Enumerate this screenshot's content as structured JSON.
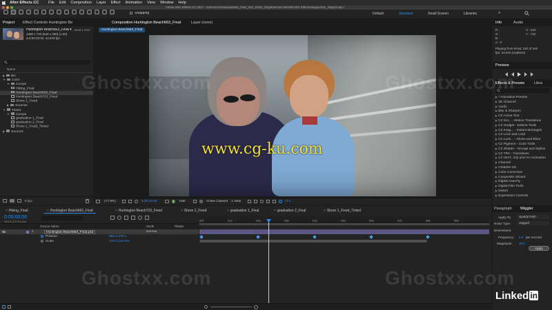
{
  "menubar": {
    "apple": "",
    "app_name": "After Effects CC",
    "items": [
      "File",
      "Edit",
      "Composition",
      "Layer",
      "Effect",
      "Animation",
      "View",
      "Window",
      "Help"
    ]
  },
  "titlebar": {
    "path": "Adobe After Effects CC 2017 - /Users/r/n/Downloads/Ex_Files_Doc_Films_Orig/Exercise Files/09 After Effects/Stages/Doc_Stage3.aep *"
  },
  "toolbar": {
    "snapping_label": "Snapping",
    "workspaces": [
      "Default",
      "Standard",
      "Small Screen",
      "Libraries"
    ],
    "active_workspace": "Standard"
  },
  "project": {
    "tabs": [
      "Project",
      "Effect Controls Huntington Be"
    ],
    "selected_item": {
      "name": "Huntington Beach663_Final ▾",
      "used": ", used 1 time",
      "dims": "1280 x 720 (640 x 360) (1.00)",
      "duration": "Δ 0:00:20:00, 23.976 fps"
    },
    "search_placeholder": "",
    "column_name": "Name",
    "tree": [
      {
        "label": "Bin",
        "indent": 0,
        "open": false,
        "type": "folder"
      },
      {
        "label": "Color",
        "indent": 0,
        "open": true,
        "type": "folder"
      },
      {
        "label": "Comps",
        "indent": 1,
        "open": true,
        "type": "folder"
      },
      {
        "label": "Hiking_Final",
        "indent": 2,
        "type": "comp"
      },
      {
        "label": "Huntington Beach663_Final",
        "indent": 2,
        "type": "comp",
        "selected": true
      },
      {
        "label": "Huntington Beach723_Fixed",
        "indent": 2,
        "type": "comp"
      },
      {
        "label": "Shore 2_Fixed",
        "indent": 2,
        "type": "comp"
      },
      {
        "label": "Sources",
        "indent": 1,
        "open": false,
        "type": "folder"
      },
      {
        "label": "Tinted",
        "indent": 0,
        "open": true,
        "type": "folder"
      },
      {
        "label": "Comps",
        "indent": 1,
        "open": true,
        "type": "folder"
      },
      {
        "label": "graduation 1_Final",
        "indent": 2,
        "type": "comp"
      },
      {
        "label": "graduation 2_Final",
        "indent": 2,
        "type": "comp"
      },
      {
        "label": "Shore 1_Fixed_Tinted",
        "indent": 2,
        "type": "comp"
      },
      {
        "label": "Sources",
        "indent": 0,
        "open": false,
        "type": "folder"
      }
    ],
    "bpc": "8 bpc"
  },
  "viewer": {
    "tab_label": "Composition Huntington Beach663_Final",
    "layer_tab": "Layer (none)",
    "comp_chip": "Huntington Beach663_Final",
    "zoom": "(77.9%)",
    "timecode": "0:00:02:08",
    "resolution": "Half",
    "camera": "Active Camera",
    "views": "1 View",
    "exposure": "+0.0",
    "overlay_url": "www.cg-ku.com"
  },
  "info": {
    "tabs": [
      "Info",
      "Audio"
    ],
    "r": "R :",
    "g": "G :",
    "b": "B :",
    "a": "A : 0",
    "x": "X : 310",
    "y": "Y : 720",
    "status1": "Playing from RAM: 240 of 240",
    "status2": "fps: 23.976 (realtime)"
  },
  "preview": {
    "title": "Preview"
  },
  "effects": {
    "tabs": [
      "Effects & Presets",
      "Libra"
    ],
    "search_placeholder": "",
    "items": [
      "* Animation Presets",
      "3D Channel",
      "Audio",
      "Blur & Sharpen",
      "C2 Active Text",
      "C2 Dxt... - Motion Transitions",
      "C2 Gadget - Editors Tools",
      "C2 Imag... - Instant Montages",
      "C2 Lock and Load",
      "C2 Lumi... - Glows and Blurs",
      "C2 Pigment - Color Tools",
      "C2 Shatter - Grunge and Stylise",
      "C2 TRX - Transitions",
      "C2 VenT...EQ and VU Animation",
      "Channel",
      "CINEMA 4D",
      "Color Correction",
      "Composite Wizard",
      "Digital Anarchy",
      "Digital Film Tools",
      "Distort",
      "Expression Controls"
    ]
  },
  "timeline": {
    "tabs": [
      "Hiking_Final",
      "Huntington Beach663_Final",
      "Huntington Beach723_Fixed",
      "Shore 2_Fixed",
      "graduation 1_Final",
      "graduation 2_Final",
      "Shore 1_Fixed_Tinted"
    ],
    "active_tab": "Huntington Beach663_Final",
    "timecode": "0:00:00:00",
    "fps_note": "00000 (23.976 fps)",
    "col_source": "Source Name",
    "col_mode": "Mode",
    "col_trkmat": "TrkMat",
    "layer_num": "1",
    "layer_name": "Huntington Beach663_Final.psd",
    "layer_mode": "Normal",
    "props": [
      {
        "name": "Position",
        "value": "858.3,279.1"
      },
      {
        "name": "Scale",
        "value": "144.0,144.0%"
      }
    ],
    "ruler": [
      "00f",
      "01s",
      "02s",
      "03s",
      "04s",
      "05s",
      "06s",
      "07s",
      "08s",
      "09s"
    ],
    "playhead_label": ""
  },
  "paragraph": {
    "tabs": [
      "Paragraph",
      "Wiggler"
    ],
    "apply_to_label": "Apply To:",
    "apply_to_value": "Spatial Path",
    "noise_label": "Noise Type:",
    "noise_value": "Jagged",
    "dimensions_label": "Dimensions:",
    "frequency_label": "Frequency:",
    "frequency_value": "0.5",
    "frequency_unit": "per second",
    "magnitude_label": "Magnitude:",
    "magnitude_value": "30.0",
    "apply_button": "Apply"
  },
  "watermarks": [
    "Ghostxx.com",
    "Ghostxx.com",
    "Ghostxx.com",
    "Ghostxx.com"
  ],
  "brand": "Linked",
  "brand_in": "in",
  "colors": {
    "accent": "#2d8ceb",
    "panel": "#232323",
    "bg": "#1d1d1d"
  }
}
